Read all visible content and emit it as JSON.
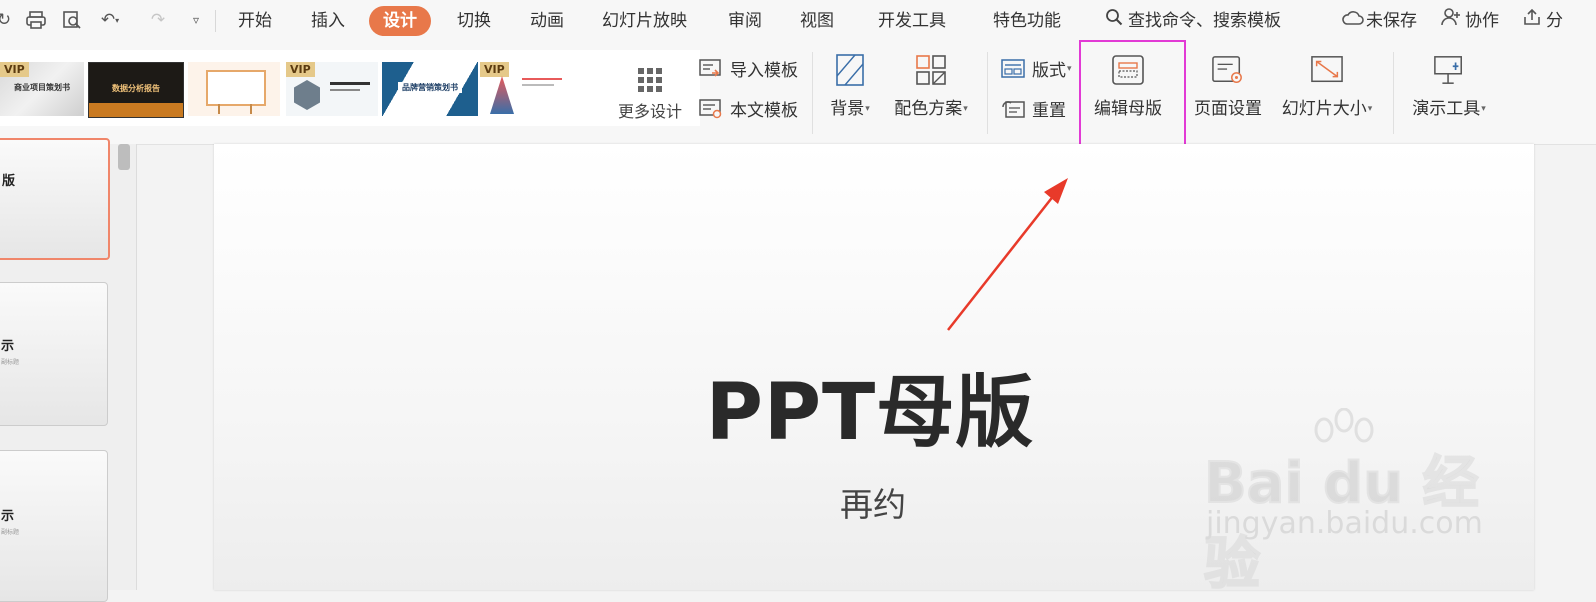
{
  "menubar": {
    "tabs": [
      {
        "label": "开始"
      },
      {
        "label": "插入"
      },
      {
        "label": "设计"
      },
      {
        "label": "切换"
      },
      {
        "label": "动画"
      },
      {
        "label": "幻灯片放映"
      },
      {
        "label": "审阅"
      },
      {
        "label": "视图"
      },
      {
        "label": "开发工具"
      },
      {
        "label": "特色功能"
      }
    ],
    "active_tab": "设计",
    "search_label": "查找命令、搜索模板",
    "unsaved_label": "未保存",
    "collab_label": "协作",
    "share_label": "分"
  },
  "ribbon": {
    "gallery": {
      "vip_badge": "VIP",
      "thumbs": [
        {
          "text": "商业项目策划书",
          "vip": true
        },
        {
          "text": "数据分析报告",
          "vip": false
        },
        {
          "text": "",
          "vip": false
        },
        {
          "text": "",
          "vip": true
        },
        {
          "text": "品牌营销策划书",
          "vip": false
        },
        {
          "text": "",
          "vip": true
        }
      ],
      "more_label": "更多设计"
    },
    "import_template": "导入模板",
    "text_template": "本文模板",
    "background": "背景",
    "color_scheme": "配色方案",
    "layout": "版式",
    "reset": "重置",
    "edit_master": "编辑母版",
    "page_setup": "页面设置",
    "slide_size": "幻灯片大小",
    "presentation_tools": "演示工具"
  },
  "left_panel": {
    "slides": [
      {
        "title": "版",
        "sub": ""
      },
      {
        "title": "示",
        "sub": "副标题"
      },
      {
        "title": "示",
        "sub": "副标题"
      }
    ]
  },
  "slide": {
    "title": "PPT母版",
    "subtitle": "再约"
  },
  "watermark": {
    "main": "Bai du 经验",
    "sub": "jingyan.baidu.com"
  },
  "colors": {
    "accent": "#e8784a",
    "highlight": "#e23ad5",
    "arrow": "#e83a2a"
  }
}
